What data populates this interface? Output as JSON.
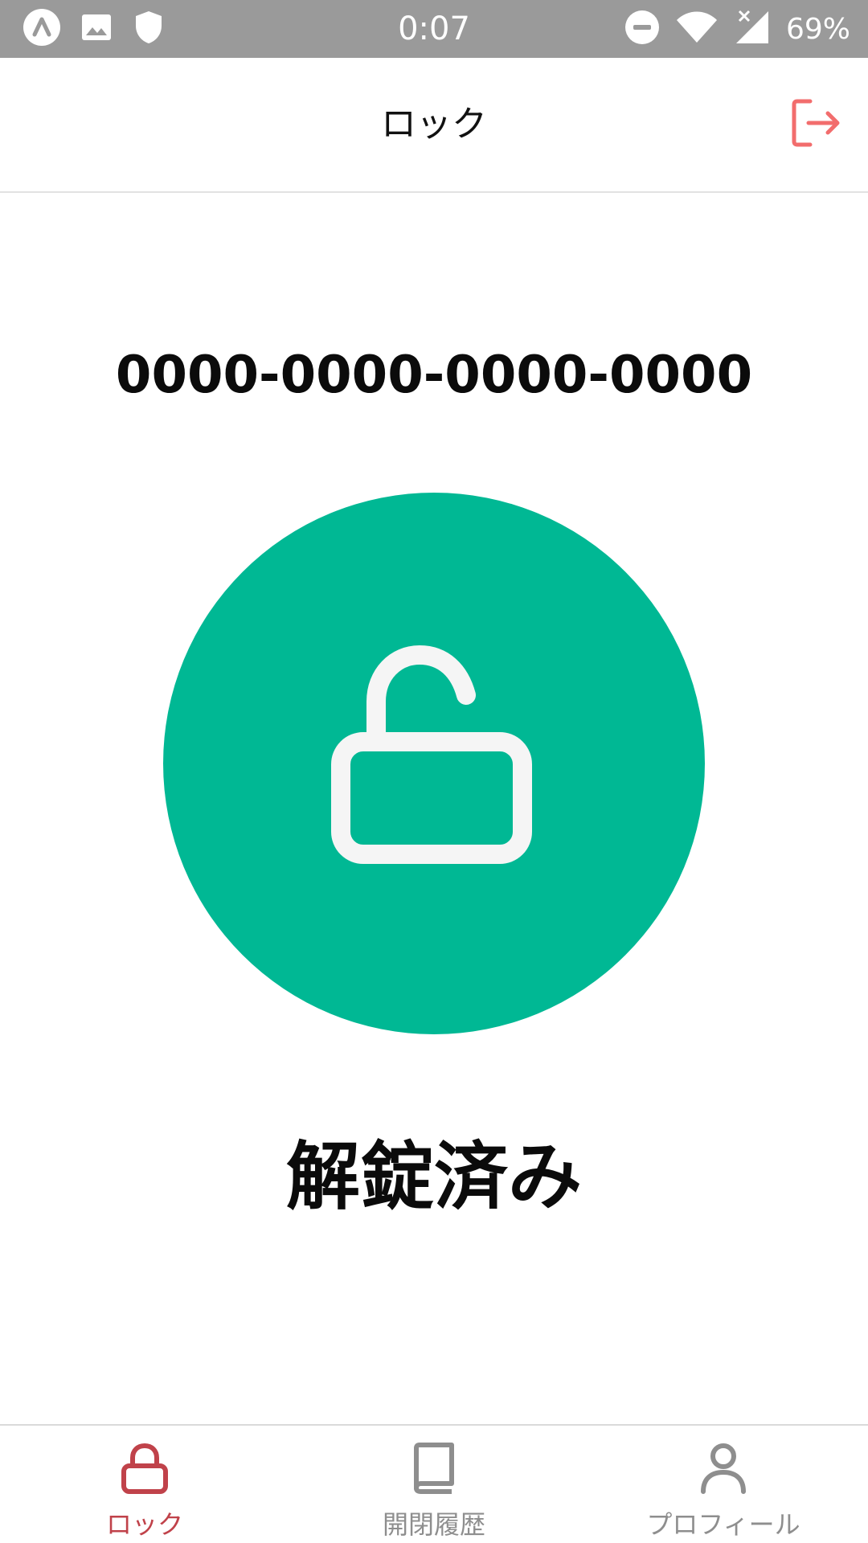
{
  "status_bar": {
    "time": "0:07",
    "battery": "69%",
    "icons_left": [
      "app-icon",
      "image-icon",
      "shield-icon"
    ],
    "icons_right": [
      "dnd-icon",
      "wifi-icon",
      "signal-icon"
    ]
  },
  "header": {
    "title": "ロック",
    "logout_icon": "logout-icon"
  },
  "main": {
    "device_id": "0000-0000-0000-0000",
    "lock_icon": "unlocked-padlock-icon",
    "status_text": "解錠済み"
  },
  "nav": {
    "items": [
      {
        "label": "ロック",
        "icon": "lock-icon",
        "active": true
      },
      {
        "label": "開閉履歴",
        "icon": "book-icon",
        "active": false
      },
      {
        "label": "プロフィール",
        "icon": "user-icon",
        "active": false
      }
    ]
  },
  "colors": {
    "accent_green": "#00b894",
    "active_red": "#c0424a",
    "logout_red": "#f26d6d",
    "inactive_gray": "#8e8e8e",
    "status_bar": "#9a9a9a"
  }
}
